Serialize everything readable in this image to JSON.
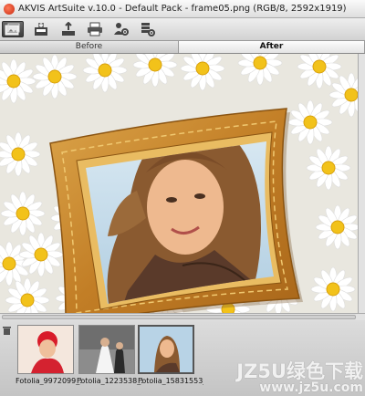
{
  "window": {
    "title": "AKVIS ArtSuite v.10.0 - Default Pack - frame05.png (RGB/8, 2592x1919)"
  },
  "toolbar": {
    "buttons": [
      {
        "name": "open-image-icon",
        "tooltip": "Open"
      },
      {
        "name": "save-icon",
        "tooltip": "Save"
      },
      {
        "name": "export-icon",
        "tooltip": "Export"
      },
      {
        "name": "print-icon",
        "tooltip": "Print"
      },
      {
        "name": "settings-person-icon",
        "tooltip": "Preferences"
      },
      {
        "name": "batch-settings-icon",
        "tooltip": "Batch"
      }
    ]
  },
  "tabs": {
    "before": "Before",
    "after": "After",
    "active": "after"
  },
  "filmstrip": {
    "thumbnails": [
      {
        "label": "Fotolia_9972099_S...",
        "selected": false
      },
      {
        "label": "Fotolia_1223538_S...",
        "selected": false
      },
      {
        "label": "Fotolia_15831553_...",
        "selected": true
      }
    ]
  },
  "watermark": {
    "main": "JZ5U绿色下载",
    "sub": "www.jz5u.com"
  },
  "colors": {
    "frame": "#c9882d",
    "photo_bg": "#bcd6e8",
    "daisy_petal": "#ffffff",
    "daisy_center": "#f2c21a"
  }
}
